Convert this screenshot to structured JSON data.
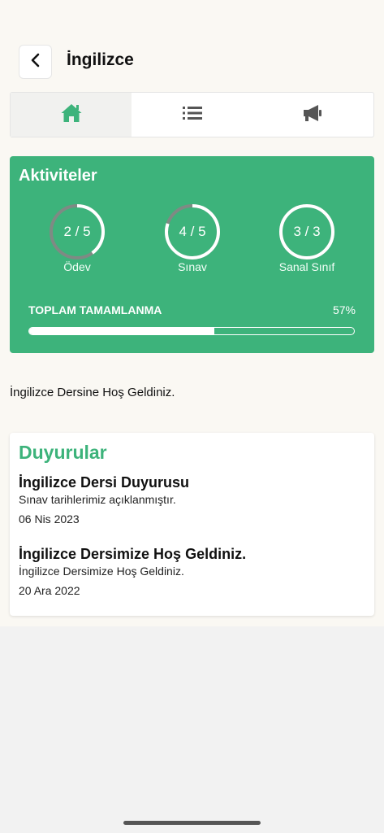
{
  "header": {
    "title": "İngilizce"
  },
  "tabs": [
    {
      "icon": "home-icon",
      "active": true
    },
    {
      "icon": "list-icon",
      "active": false
    },
    {
      "icon": "megaphone-icon",
      "active": false
    }
  ],
  "activities": {
    "title": "Aktiviteler",
    "items": [
      {
        "label": "Ödev",
        "done": 2,
        "total": 5,
        "text": "2 / 5"
      },
      {
        "label": "Sınav",
        "done": 4,
        "total": 5,
        "text": "4 / 5"
      },
      {
        "label": "Sanal Sınıf",
        "done": 3,
        "total": 3,
        "text": "3 / 3"
      }
    ],
    "total_label": "TOPLAM TAMAMLANMA",
    "total_percent_text": "57%",
    "total_percent": 57
  },
  "welcome_text": "İngilizce Dersine Hoş Geldiniz.",
  "announcements": {
    "title": "Duyurular",
    "items": [
      {
        "title": "İngilizce Dersi Duyurusu",
        "body": "Sınav tarihlerimiz açıklanmıştır.",
        "date": "06 Nis 2023"
      },
      {
        "title": "İngilizce Dersimize Hoş Geldiniz.",
        "body": "İngilizce Dersimize Hoş Geldiniz.",
        "date": "20 Ara 2022"
      }
    ]
  },
  "colors": {
    "accent": "#3db37b",
    "ring_track": "#7f8a84",
    "ring_progress": "#ffffff",
    "icon_active": "#3db37b",
    "icon_inactive": "#555555"
  }
}
